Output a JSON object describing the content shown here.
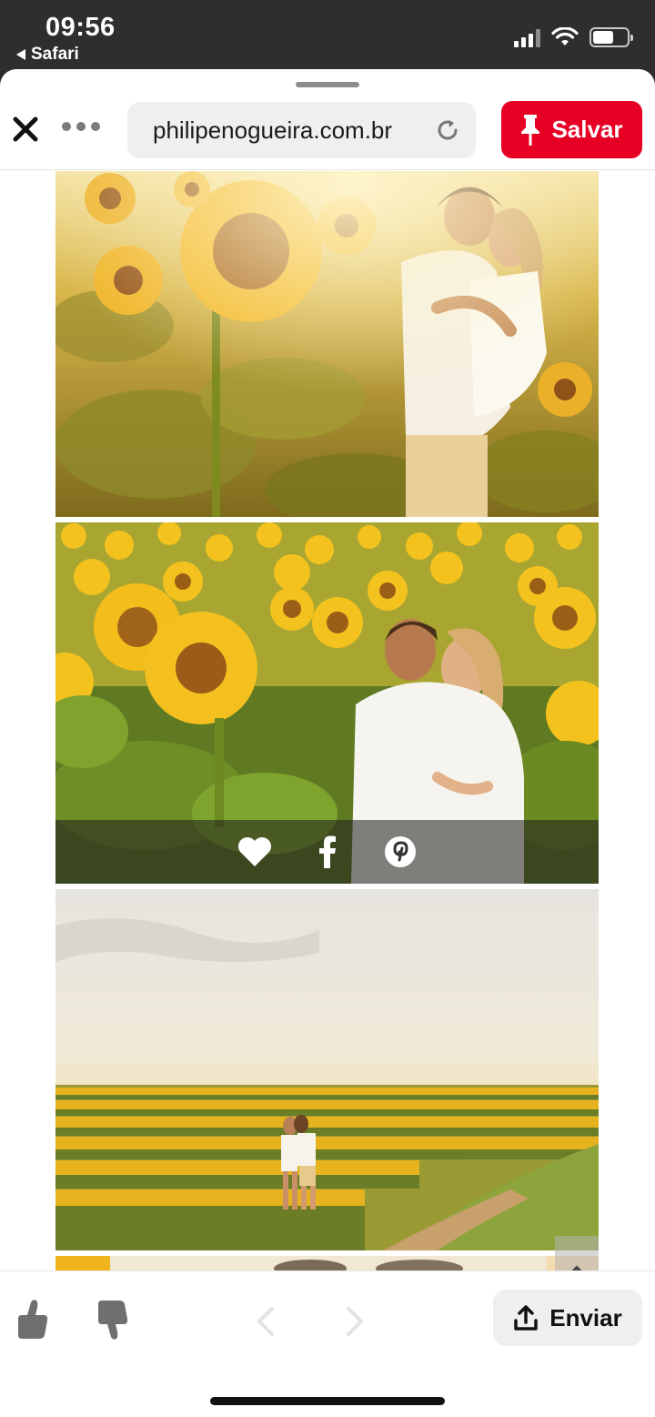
{
  "status_bar": {
    "time": "09:56",
    "back_app": "Safari",
    "icons": [
      "cellular-signal-icon",
      "wifi-icon",
      "battery-icon"
    ]
  },
  "toolbar": {
    "url": "philipenogueira.com.br",
    "save_label": "Salvar",
    "icons": [
      "close-icon",
      "more-icon",
      "reload-icon",
      "pin-icon"
    ]
  },
  "page": {
    "photos": [
      {
        "subject": "couple-embracing-sunflower-field-closeup"
      },
      {
        "subject": "couple-hugging-among-sunflowers",
        "share_icons": [
          "heart-icon",
          "facebook-icon",
          "pinterest-icon"
        ]
      },
      {
        "subject": "couple-standing-in-sunflower-field-wide"
      }
    ],
    "icons": [
      "hamburger-menu-icon",
      "chevron-up-icon"
    ]
  },
  "bottom_bar": {
    "send_label": "Enviar",
    "icons": [
      "thumbs-up-icon",
      "thumbs-down-icon",
      "back-arrow-icon",
      "forward-arrow-icon",
      "share-upload-icon"
    ]
  },
  "colors": {
    "save_button": "#e60023",
    "status_bar_bg": "#2e2e2e"
  }
}
